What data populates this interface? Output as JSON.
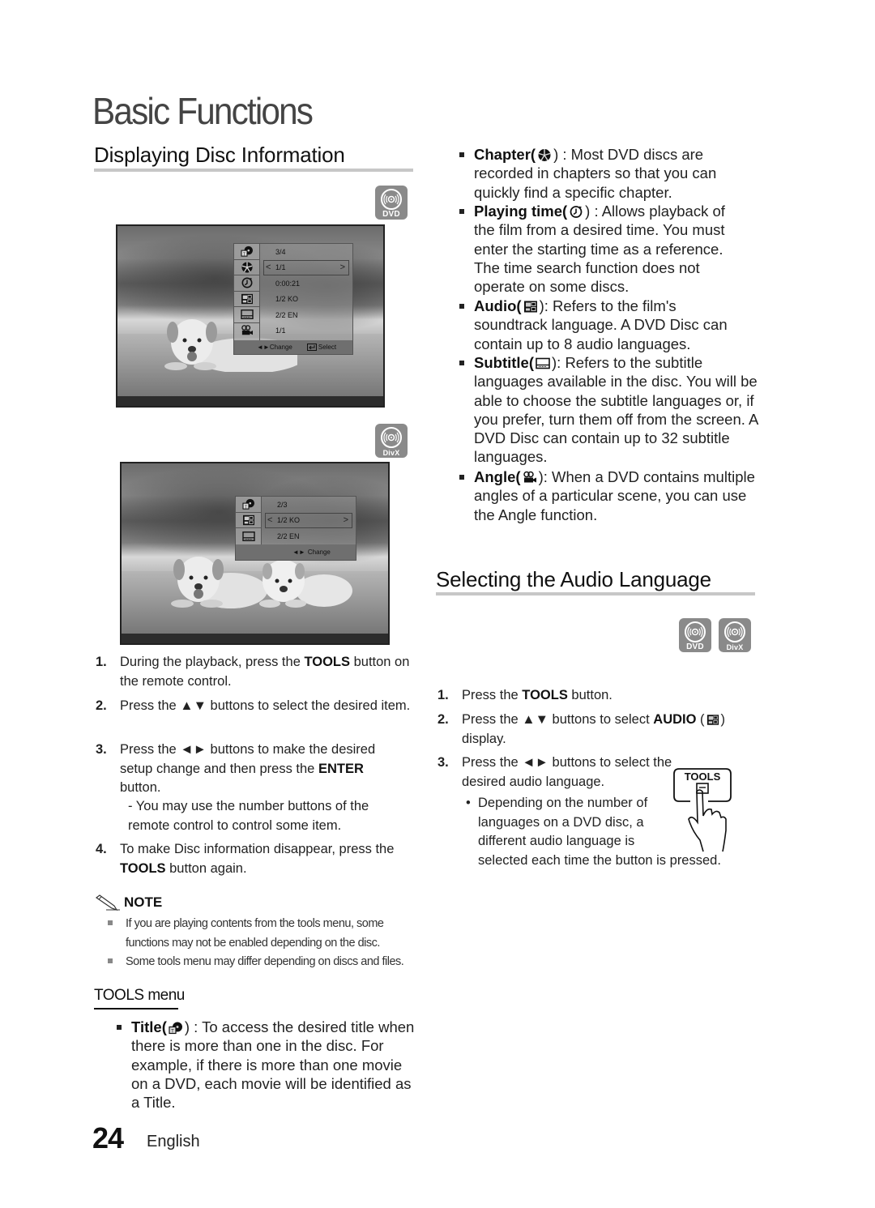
{
  "chapter_title": "Basic Functions",
  "left": {
    "section_title": "Displaying Disc Information",
    "badge_dvd": "DVD",
    "badge_divx": "DivX",
    "dvd_osd": {
      "rows": [
        "3/4",
        "1/1",
        "0:00:21",
        "1/2 KO",
        "2/2 EN",
        "1/1"
      ],
      "selected_index": 1,
      "icons": [
        "title-icon",
        "chapter-icon",
        "playing-time-icon",
        "audio-icon",
        "subtitle-icon",
        "angle-icon"
      ],
      "footer_change": "◄►Change",
      "footer_select": "Select"
    },
    "divx_osd": {
      "rows": [
        "2/3",
        "1/2 KO",
        "2/2 EN"
      ],
      "selected_index": 1,
      "icons": [
        "title-icon",
        "audio-icon",
        "subtitle-icon"
      ],
      "footer_change": "Change"
    },
    "steps": [
      {
        "num": "1.",
        "pre": "During the playback, press the ",
        "bold": "TOOLS",
        "post": " button on the remote control."
      },
      {
        "num": "2.",
        "pre": "Press the ▲▼ buttons to select the desired item.",
        "bold": "",
        "post": ""
      },
      {
        "num": "3.",
        "pre": "Press the ◄► buttons to make the desired setup change and then press the ",
        "bold": "ENTER",
        "post": " button."
      },
      {
        "num": "4.",
        "pre": "To make Disc information disappear, press the ",
        "bold": "TOOLS",
        "post": " button again."
      }
    ],
    "step3_sub": "- You may use the number buttons of the remote control to control some item.",
    "note": {
      "label": "NOTE",
      "items": [
        "If you are playing contents from the tools menu, some functions may not be enabled depending on the disc.",
        "Some tools menu may differ depending on discs and files."
      ]
    },
    "tools_menu": {
      "heading": "TOOLS menu",
      "title_item": {
        "label": "Title(",
        "close": ") : To access the desired title when there is more than one in the disc. For example, if there is more than one movie on a DVD, each movie will be identified as a Title."
      }
    }
  },
  "right": {
    "items": [
      {
        "label": "Chapter(",
        "close": ") : Most DVD discs are recorded in chapters so that you can quickly find a specific chapter.",
        "icon": "chapter-icon"
      },
      {
        "label": "Playing time(",
        "close": ") : Allows playback of the film from a desired time. You must enter the starting time as a reference. The time search function does not operate on some discs.",
        "icon": "playing-time-icon"
      },
      {
        "label": "Audio(",
        "close": "): Refers to the film's soundtrack language. A DVD Disc can contain up to 8 audio languages.",
        "icon": "audio-icon"
      },
      {
        "label": "Subtitle(",
        "close": "): Refers to the subtitle languages available in the disc. You will be able to choose the subtitle languages or, if you prefer, turn them off from the screen. A DVD Disc can contain up to 32 subtitle languages.",
        "icon": "subtitle-icon"
      },
      {
        "label": "Angle(",
        "close": "): When a DVD contains multiple angles of a particular scene, you can use the Angle function.",
        "icon": "angle-icon"
      }
    ],
    "section_title": "Selecting the Audio Language",
    "badge_dvd": "DVD",
    "badge_divx": "DivX",
    "steps": [
      {
        "num": "1.",
        "pre": "Press the ",
        "bold": "TOOLS",
        "post": " button."
      },
      {
        "num": "2.",
        "pre": "Press the ▲▼ buttons to select ",
        "bold": "AUDIO",
        "post": " display."
      },
      {
        "num": "3.",
        "pre": "Press the ◄► buttons to select the desired audio language.",
        "bold": "",
        "post": ""
      }
    ],
    "step3_bullet": "Depending on the number of languages on a DVD disc, a different audio language is selected each time the button is pressed.",
    "tools_button_label": "TOOLS"
  },
  "footer": {
    "page_number": "24",
    "language": "English"
  }
}
